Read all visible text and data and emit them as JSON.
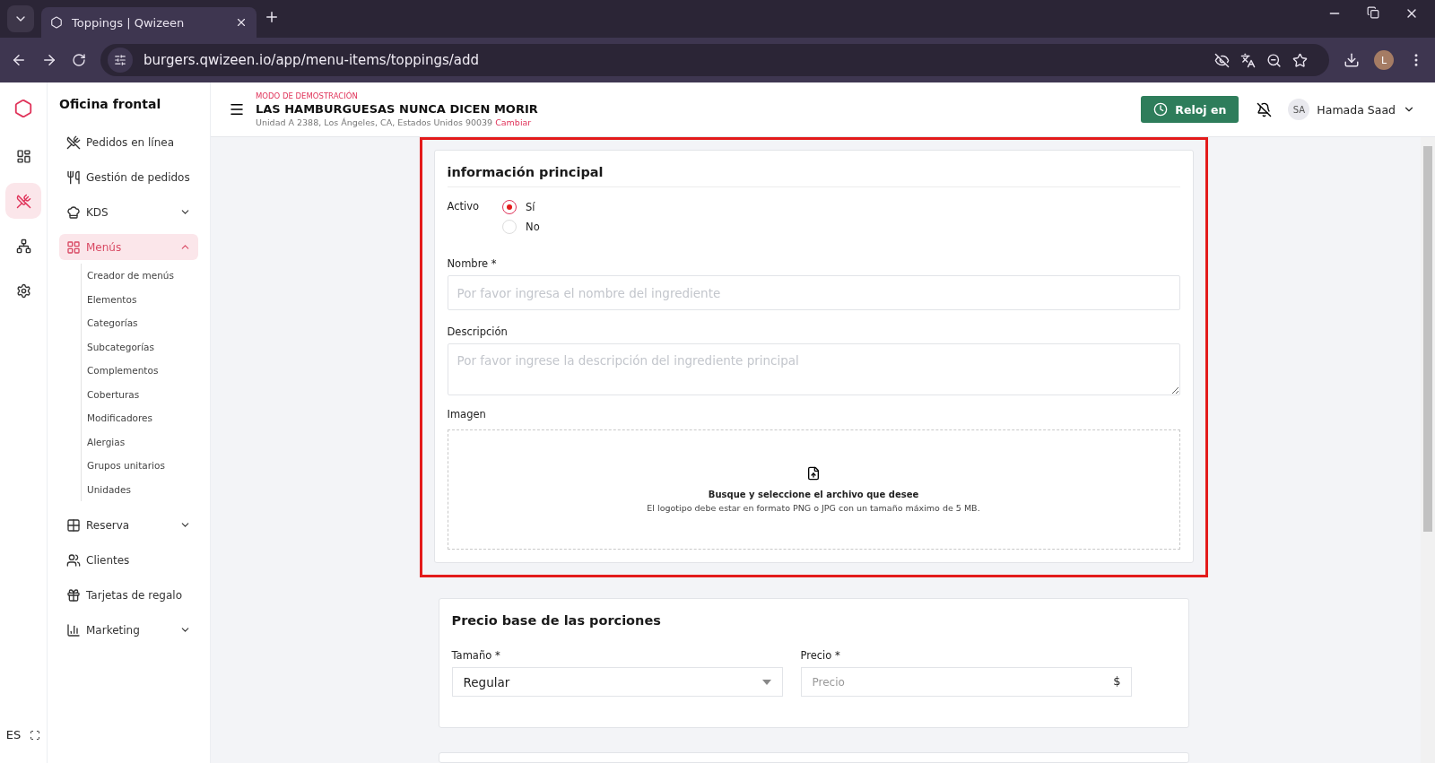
{
  "browser": {
    "tab_title": "Toppings | Qwizeen",
    "url": "burgers.qwizeen.io/app/menu-items/toppings/add",
    "profile_initial": "L"
  },
  "rail": [
    {
      "kind": "dashboard",
      "selected": false
    },
    {
      "kind": "dining",
      "selected": true
    },
    {
      "kind": "network",
      "selected": false
    },
    {
      "kind": "settings",
      "selected": false
    }
  ],
  "language": "ES",
  "sidebar": {
    "title": "Oficina frontal",
    "items": [
      {
        "kind": "dining",
        "label": "Pedidos en línea",
        "selected": false
      },
      {
        "kind": "orders",
        "label": "Gestión de pedidos",
        "selected": false
      },
      {
        "kind": "kds",
        "label": "KDS",
        "selected": false,
        "expanded": false
      },
      {
        "kind": "menus",
        "label": "Menús",
        "selected": true,
        "expanded": true,
        "children": [
          {
            "label": "Creador de menús"
          },
          {
            "label": "Elementos"
          },
          {
            "label": "Categorías"
          },
          {
            "label": "Subcategorías"
          },
          {
            "label": "Complementos"
          },
          {
            "label": "Coberturas"
          },
          {
            "label": "Modificadores"
          },
          {
            "label": "Alergias"
          },
          {
            "label": "Grupos unitarios"
          },
          {
            "label": "Unidades"
          }
        ]
      },
      {
        "kind": "reservation",
        "label": "Reserva",
        "selected": false,
        "expanded": false
      },
      {
        "kind": "clients",
        "label": "Clientes",
        "selected": false
      },
      {
        "kind": "gift",
        "label": "Tarjetas de regalo",
        "selected": false
      },
      {
        "kind": "marketing",
        "label": "Marketing",
        "selected": false,
        "expanded": false
      }
    ]
  },
  "header": {
    "demo_label": "MODO DE DEMOSTRACIÓN",
    "restaurant": "LAS HAMBURGUESAS NUNCA DICEN MORIR",
    "address": "Unidad A 2388, Los Ángeles, CA, Estados Unidos 90039",
    "change_link": "Cambiar",
    "clock_button": "Reloj en",
    "user_initials": "SA",
    "user_name": "Hamada Saad"
  },
  "main_card": {
    "title": "información principal",
    "active_label": "Activo",
    "active_options": [
      {
        "label": "Sí",
        "selected": true
      },
      {
        "label": "No",
        "selected": false
      }
    ],
    "name_label": "Nombre *",
    "name_placeholder": "Por favor ingresa el nombre del ingrediente",
    "description_label": "Descripción",
    "description_placeholder": "Por favor ingrese la descripción del ingrediente principal",
    "image_label": "Imagen",
    "upload_title": "Busque y seleccione el archivo que desee",
    "upload_hint": "El logotipo debe estar en formato PNG o JPG con un tamaño máximo de 5 MB."
  },
  "price_card": {
    "title": "Precio base de las porciones",
    "size_label": "Tamaño *",
    "size_value": "Regular",
    "price_label": "Precio *",
    "price_placeholder": "Precio",
    "currency": "$"
  }
}
